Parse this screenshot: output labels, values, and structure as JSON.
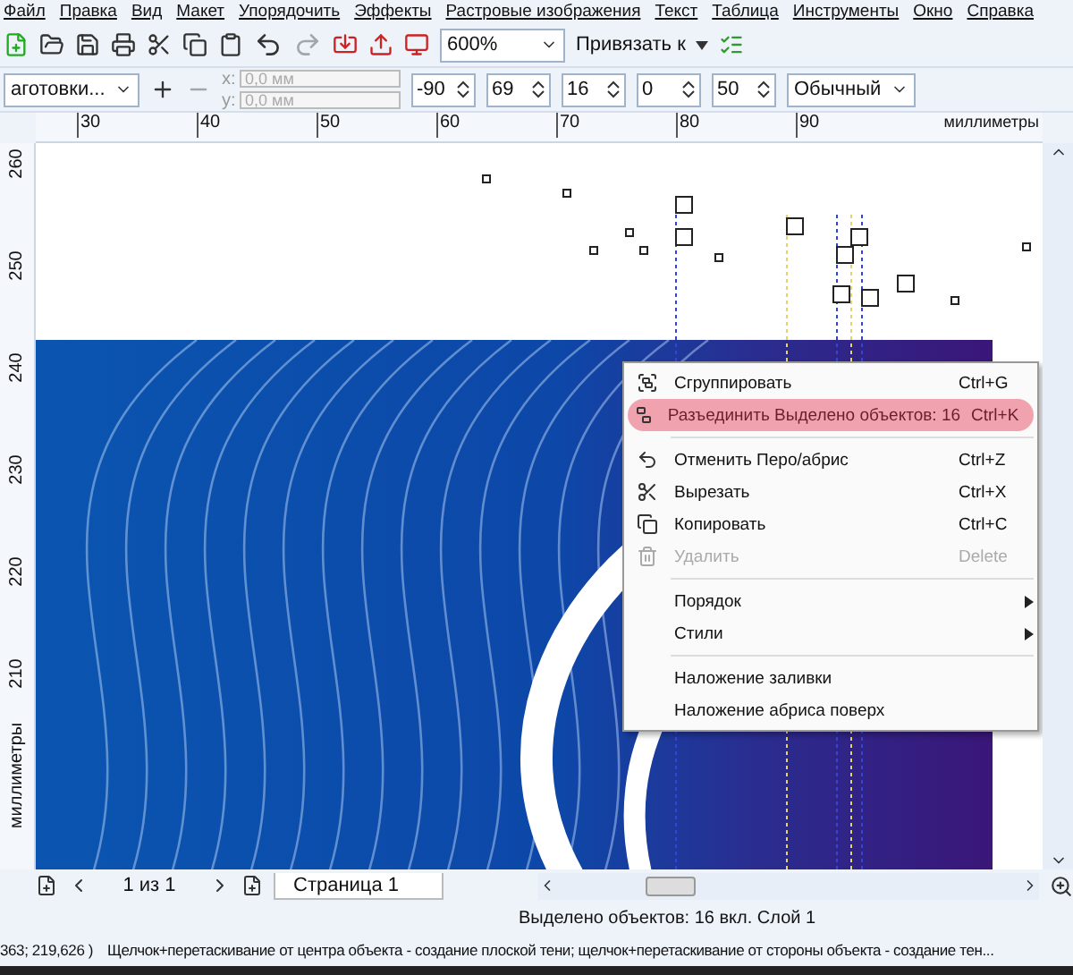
{
  "menu_bar": [
    "Файл",
    "Правка",
    "Вид",
    "Макет",
    "Упорядочить",
    "Эффекты",
    "Растровые изображения",
    "Текст",
    "Таблица",
    "Инструменты",
    "Окно",
    "Справка"
  ],
  "standard_toolbar": {
    "zoom": "600%",
    "snap": "Привязать к"
  },
  "property_bar": {
    "preset": "аготовки...",
    "x_label": "x:",
    "x": "0,0 мм",
    "y_label": "y:",
    "y": "0,0 мм",
    "direction": "-90",
    "opacity": "69",
    "feather": "16",
    "fade": "0",
    "stretch": "50",
    "mode": "Обычный"
  },
  "ruler": {
    "h_labels": [
      "30",
      "40",
      "50",
      "60",
      "70",
      "80",
      "90"
    ],
    "h_units": "миллиметры",
    "v_labels": [
      "260",
      "250",
      "240",
      "230",
      "220",
      "210"
    ],
    "v_units": "миллиметры"
  },
  "context_menu": [
    {
      "kind": "item",
      "label": "Сгруппировать",
      "shortcut": "Ctrl+G",
      "disabled": false,
      "highlighted": false
    },
    {
      "kind": "item",
      "label": "Разъединить Выделено объектов: 16",
      "shortcut": "Ctrl+K",
      "disabled": false,
      "highlighted": true
    },
    {
      "kind": "separator"
    },
    {
      "kind": "item",
      "label": "Отменить Перо/абрис",
      "shortcut": "Ctrl+Z",
      "disabled": false,
      "highlighted": false
    },
    {
      "kind": "item",
      "label": "Вырезать",
      "shortcut": "Ctrl+X",
      "disabled": false,
      "highlighted": false
    },
    {
      "kind": "item",
      "label": "Копировать",
      "shortcut": "Ctrl+C",
      "disabled": false,
      "highlighted": false
    },
    {
      "kind": "item",
      "label": "Удалить",
      "shortcut": "Delete",
      "disabled": true,
      "highlighted": false
    },
    {
      "kind": "separator"
    },
    {
      "kind": "submenu",
      "label": "Порядок"
    },
    {
      "kind": "submenu",
      "label": "Стили"
    },
    {
      "kind": "separator"
    },
    {
      "kind": "item",
      "label": "Наложение заливки",
      "disabled": false,
      "highlighted": false
    },
    {
      "kind": "item",
      "label": "Наложение абриса поверх",
      "disabled": false,
      "highlighted": false
    }
  ],
  "page_nav": {
    "counter": "1 из 1",
    "page_tab": "Страница 1"
  },
  "status_bar": {
    "selection": "Выделено объектов: 16 вкл. Слой 1",
    "coords": "363; 219,626 )",
    "hint": "Щелчок+перетаскивание от центра объекта - создание плоской тени; щелчок+перетаскивание от стороны объекта - создание тен..."
  }
}
